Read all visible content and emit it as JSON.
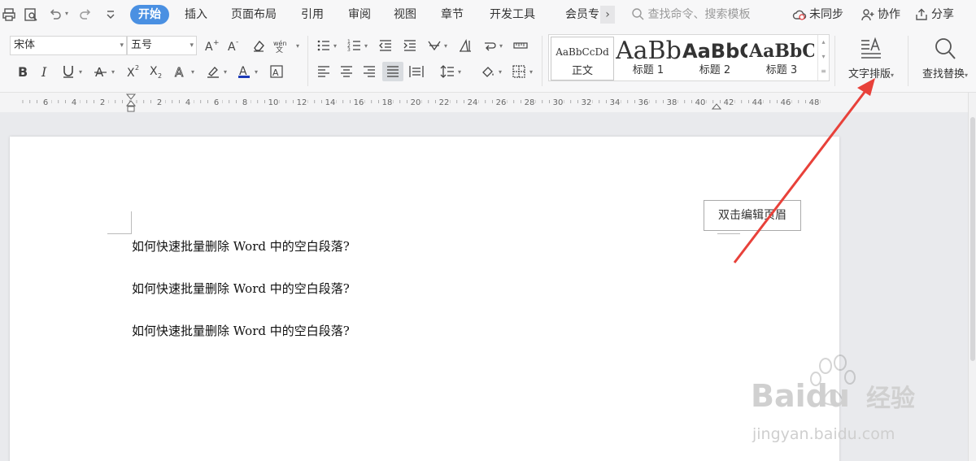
{
  "menu": {
    "tabs": [
      "开始",
      "插入",
      "页面布局",
      "引用",
      "审阅",
      "视图",
      "章节",
      "开发工具",
      "会员专"
    ],
    "more": "›",
    "search_placeholder": "查找命令、搜索模板",
    "sync": "未同步",
    "collab": "协作",
    "share": "分享"
  },
  "ribbon": {
    "font_name": "宋体",
    "font_size": "五号",
    "styles": [
      {
        "sample": "AaBbCcDd",
        "name": "正文"
      },
      {
        "sample": "AaBb",
        "name": "标题 1"
      },
      {
        "sample": "AaBbC",
        "name": "标题 2"
      },
      {
        "sample": "AaBbC",
        "name": "标题 3"
      }
    ],
    "text_layout": "文字排版",
    "find_replace": "查找替换"
  },
  "ruler": {
    "labels": [
      "6",
      "4",
      "2",
      "2",
      "4",
      "6",
      "8",
      "10",
      "12",
      "14",
      "16",
      "18",
      "20",
      "22",
      "24",
      "26",
      "28",
      "30",
      "32",
      "34",
      "36",
      "38",
      "40",
      "42",
      "44",
      "46",
      "48"
    ]
  },
  "document": {
    "paragraphs": [
      "如何快速批量删除 Word 中的空白段落?",
      "如何快速批量删除 Word 中的空白段落?",
      "如何快速批量删除 Word 中的空白段落?"
    ],
    "header_tip": "双击编辑页眉"
  },
  "watermark": {
    "brand": "Baidu",
    "suffix": "经验",
    "url": "jingyan.baidu.com"
  },
  "colors": {
    "accent": "#4a90e2",
    "annotation_arrow": "#e8413a"
  }
}
